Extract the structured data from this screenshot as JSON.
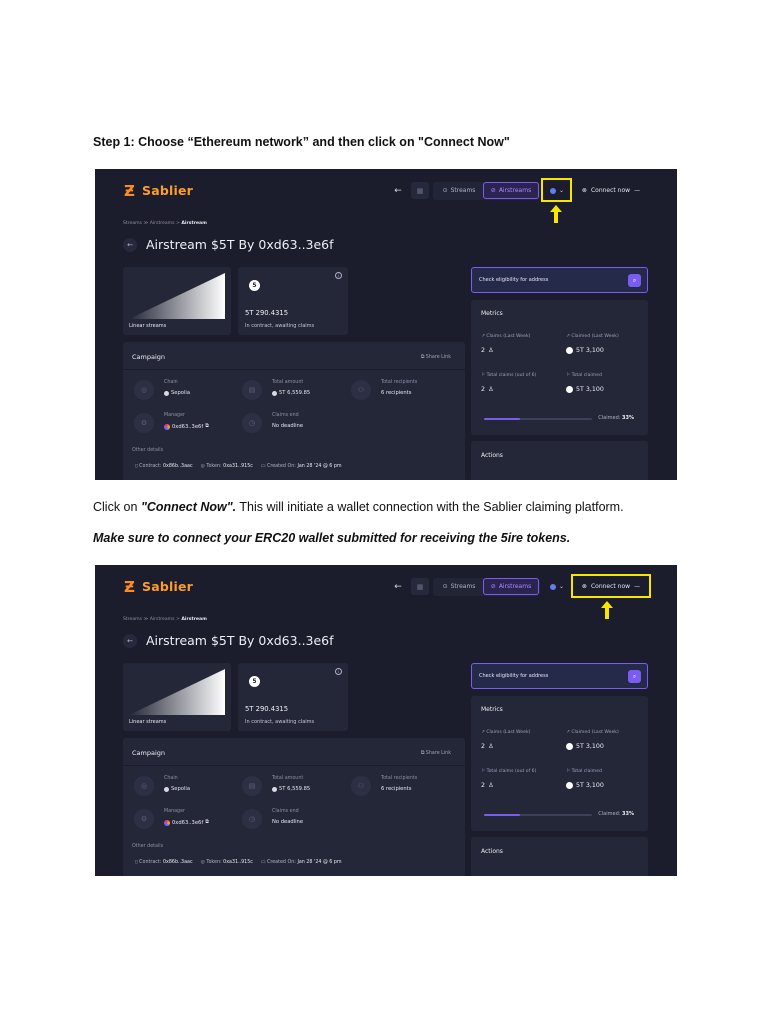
{
  "document": {
    "step1": "Step 1: Choose “Ethereum network” and then click on \"Connect Now\"",
    "click_prefix": "Click on ",
    "click_em": "\"Connect Now\".",
    "click_rest": " This will initiate a wallet connection with the Sablier claiming platform.",
    "make_sure": "Make sure to connect your ERC20 wallet submitted for receiving the 5ire tokens."
  },
  "colors": {
    "highlight": "#f7e600",
    "accent": "#7a5cf0",
    "brand": "#ff9c2a",
    "background": "#1b1d2c"
  },
  "app": {
    "brand": "Sablier",
    "nav": {
      "back_icon": "arrow-left-icon",
      "streams": "Streams",
      "airstreams": "Airstreams",
      "chain_icon": "ethereum-icon",
      "connect": "Connect now",
      "more": "—"
    },
    "breadcrumb": {
      "streams": "Streams",
      "sep1": " ≫ ",
      "airstreams": "Airstreams",
      "sep2": " > ",
      "current": "Airstream"
    },
    "title": "Airstream $5T By 0xd63..3e6f",
    "chart_card": {
      "label": "Linear streams"
    },
    "amount_card": {
      "value": "5T 290.4315",
      "subtitle": "In contract, awaiting claims"
    },
    "campaign": {
      "title": "Campaign",
      "share": "Share Link",
      "fields": {
        "chain_label": "Chain",
        "chain_value": "Sepolia",
        "total_amount_label": "Total amount",
        "total_amount_value": "5T 6,559.85",
        "recipients_label": "Total recipients",
        "recipients_value": "6 recipients",
        "manager_label": "Manager",
        "manager_value": "0xd63..3e6f",
        "claims_end_label": "Claims end",
        "claims_end_value": "No deadline"
      },
      "other_title": "Other details",
      "contract_label": "Contract: ",
      "contract_value": "0x86b..3aac",
      "token_label": "Token: ",
      "token_value": "0xa31..915c",
      "created_label": "Created On: ",
      "created_value": "Jan 28 '24 @ 6 pm"
    },
    "eligibility": {
      "placeholder": "Check eligibility for address"
    },
    "metrics": {
      "title": "Metrics",
      "claims_last_week_label": "Claims (Last Week)",
      "claims_last_week_value": "2",
      "claimed_last_week_label": "Claimed (Last Week)",
      "claimed_last_week_value": "5T 3,100",
      "total_claims_label": "Total claims (out of 6)",
      "total_claims_value": "2",
      "total_claimed_label": "Total claimed",
      "total_claimed_value": "5T 3,100",
      "claimed_label": "Claimed:",
      "claimed_percent": "33%",
      "claimed_fraction": 0.33
    },
    "actions": {
      "title": "Actions"
    }
  }
}
